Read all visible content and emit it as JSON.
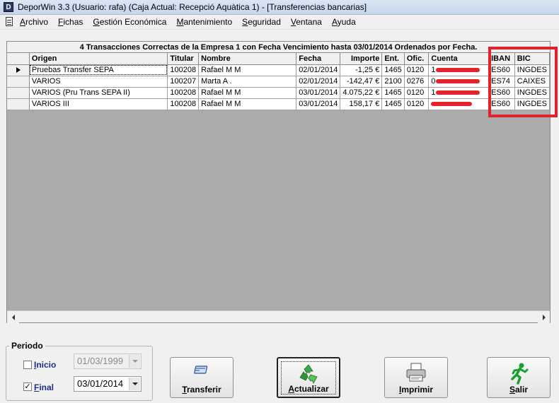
{
  "window": {
    "title": "DeporWin 3.3  (Usuario: rafa)  (Caja Actual: Recepció Aquàtica 1) - [Transferencias bancarias]",
    "icon": "deporwin-app-icon"
  },
  "menu": {
    "items": [
      {
        "first": "A",
        "rest": "rchivo"
      },
      {
        "first": "F",
        "rest": "ichas"
      },
      {
        "first": "G",
        "rest": "estión Económica"
      },
      {
        "first": "M",
        "rest": "antenimiento"
      },
      {
        "first": "S",
        "rest": "eguridad"
      },
      {
        "first": "V",
        "rest": "entana"
      },
      {
        "first": "A",
        "rest": "yuda"
      }
    ]
  },
  "grid": {
    "caption": "4 Transacciones Correctas de la Empresa 1 con Fecha Vencimiento hasta 03/01/2014 Ordenados por Fecha.",
    "columns": [
      "Origen",
      "Titular",
      "Nombre",
      "Fecha",
      "Importe",
      "Ent.",
      "Ofic.",
      "Cuenta",
      "IBAN",
      "BIC"
    ],
    "rows": [
      {
        "origen": "Pruebas Transfer SEPA",
        "titular": "100208",
        "nombre": "Rafael M        M",
        "fecha": "02/01/2014",
        "importe": "-1,25 €",
        "ent": "1465",
        "ofic": "0120",
        "cuenta_prefix": "1",
        "iban": "ES60",
        "bic": "INGDES"
      },
      {
        "origen": "VARIOS",
        "titular": "100207",
        "nombre": "Marta A              .",
        "fecha": "02/01/2014",
        "importe": "-142,47 €",
        "ent": "2100",
        "ofic": "0276",
        "cuenta_prefix": "0",
        "iban": "ES74",
        "bic": "CAIXES"
      },
      {
        "origen": "VARIOS (Pru Trans SEPA II)",
        "titular": "100208",
        "nombre": "Rafael M        M",
        "fecha": "03/01/2014",
        "importe": "4.075,22 €",
        "ent": "1465",
        "ofic": "0120",
        "cuenta_prefix": "1",
        "iban": "ES60",
        "bic": "INGDES"
      },
      {
        "origen": "VARIOS III",
        "titular": "100208",
        "nombre": "Rafael M        M",
        "fecha": "03/01/2014",
        "importe": "158,17 €",
        "ent": "1465",
        "ofic": "0120",
        "cuenta_prefix": "",
        "iban": "ES60",
        "bic": "INGDES"
      }
    ]
  },
  "periodo": {
    "legend": "Periodo",
    "inicio": {
      "first": "I",
      "rest": "nicio",
      "checked": false,
      "check_mark": "",
      "date": "01/03/1999",
      "enabled": false
    },
    "final": {
      "first": "F",
      "rest": "inal",
      "checked": true,
      "check_mark": "✓",
      "date": "03/01/2014",
      "enabled": true
    }
  },
  "buttons": {
    "transferir": {
      "first": "T",
      "rest": "ransferir",
      "icon": "transfer-card-icon"
    },
    "actualizar": {
      "first": "A",
      "rest": "ctualizar",
      "icon": "recycle-icon"
    },
    "imprimir": {
      "first": "I",
      "rest": "mprimir",
      "icon": "printer-icon"
    },
    "salir": {
      "first": "S",
      "rest": "alir",
      "icon": "running-man-icon"
    }
  },
  "colors": {
    "highlight_box": "#e0222a",
    "redaction": "#e8202a",
    "label_blue": "#1b2f8e"
  }
}
